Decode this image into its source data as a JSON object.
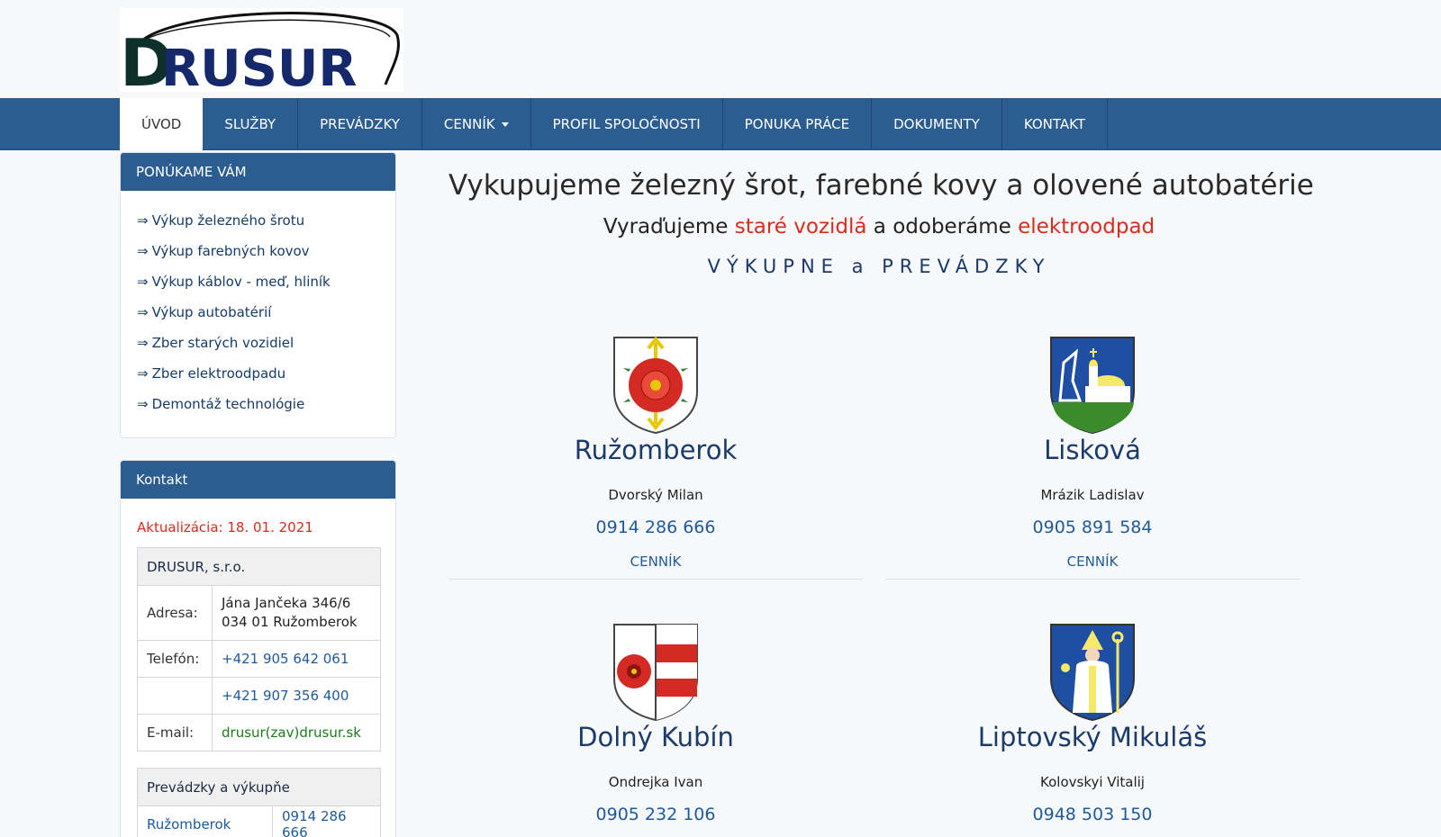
{
  "brand": {
    "logo_text": "DRUSUR"
  },
  "nav": {
    "items": [
      {
        "label": "ÚVOD",
        "active": true
      },
      {
        "label": "SLUŽBY"
      },
      {
        "label": "PREVÁDZKY"
      },
      {
        "label": "CENNÍK",
        "dropdown": true
      },
      {
        "label": "PROFIL SPOLOČNOSTI"
      },
      {
        "label": "PONUKA PRÁCE"
      },
      {
        "label": "DOKUMENTY"
      },
      {
        "label": "KONTAKT"
      }
    ]
  },
  "sidebar": {
    "offer": {
      "title": "PONÚKAME VÁM",
      "arrow": "⇒",
      "items": [
        "Výkup železného šrotu",
        "Výkup farebných kovov",
        "Výkup káblov - meď, hliník",
        "Výkup autobatérií",
        "Zber starých vozidiel",
        "Zber elektroodpadu",
        "Demontáž technológie"
      ]
    },
    "contact": {
      "title": "Kontakt",
      "update": "Aktualizácia: 18. 01. 2021",
      "company": "DRUSUR, s.r.o.",
      "address_label": "Adresa:",
      "address_line1": "Jána Jančeka 346/6",
      "address_line2": "034 01 Ružomberok",
      "phone_label": "Telefón:",
      "phone1": "+421 905 642 061",
      "phone2": "+421 907 356 400",
      "email_label": "E-mail:",
      "email": "drusur(zav)drusur.sk",
      "branches_title": "Prevádzky a výkupňe",
      "branches": [
        {
          "city": "Ružomberok",
          "phone": "0914 286 666"
        }
      ]
    }
  },
  "main": {
    "title": "Vykupujeme železný šrot, farebné kovy a olovené autobatérie",
    "sub_a": "Vyraďujeme ",
    "sub_b": "staré vozidlá",
    "sub_c": " a odoberáme ",
    "sub_d": "elektroodpad",
    "section": "VÝKUPNE a PREVÁDZKY",
    "price_label": "CENNÍK",
    "cards": [
      {
        "city": "Ružomberok",
        "person": "Dvorský Milan",
        "phone": "0914 286 666",
        "crest": "rose-crest-icon"
      },
      {
        "city": "Lisková",
        "person": "Mrázik Ladislav",
        "phone": "0905 891 584",
        "crest": "church-crest-icon"
      },
      {
        "city": "Dolný Kubín",
        "person": "Ondrejka Ivan",
        "phone": "0905 232 106",
        "crest": "rose-stripes-crest-icon"
      },
      {
        "city": "Liptovský Mikuláš",
        "person": "Kolovskyi Vitalij",
        "phone": "0948 503 150",
        "crest": "saint-crest-icon"
      }
    ]
  },
  "colors": {
    "nav_blue": "#2c5d91",
    "accent_red": "#d92c1e",
    "link_blue": "#1e5a9c",
    "title_navy": "#1b3c6b"
  }
}
